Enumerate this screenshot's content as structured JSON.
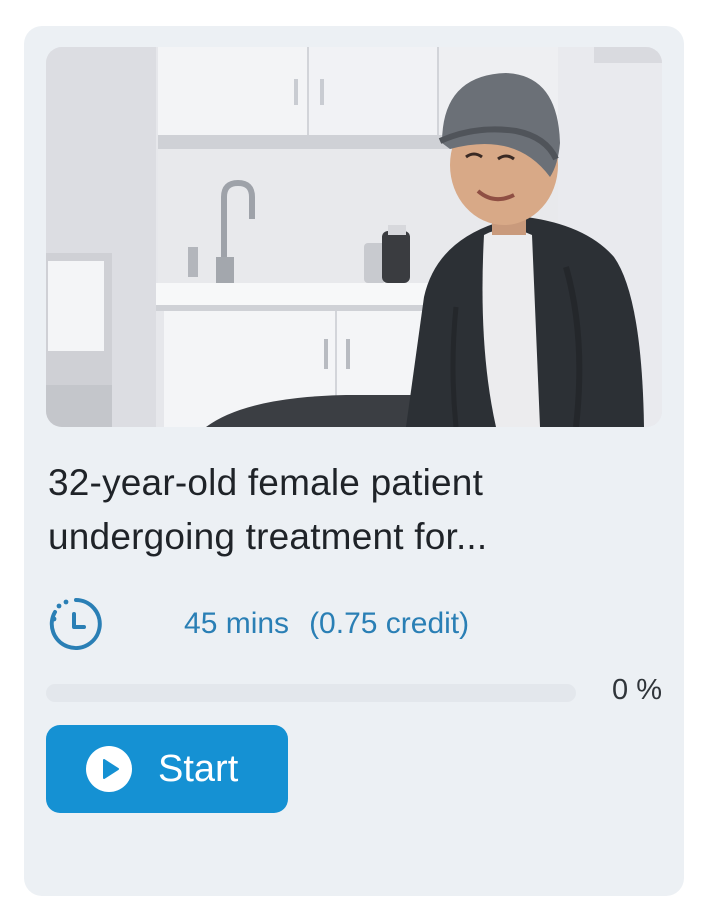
{
  "card": {
    "title": "32-year-old female patient undergoing treatment for...",
    "duration": "45 mins",
    "credit": "(0.75 credit)",
    "progress": {
      "percent": 0,
      "label": "0 %"
    },
    "start_label": "Start",
    "thumbnail": {
      "description_icon": "patient-photo"
    }
  },
  "colors": {
    "card_background": "#ecf0f4",
    "accent": "#1591d3",
    "meta_text": "#2a7fb5",
    "title_text": "#1f2328"
  },
  "icons": {
    "duration": "clock-icon",
    "start": "play-icon"
  }
}
